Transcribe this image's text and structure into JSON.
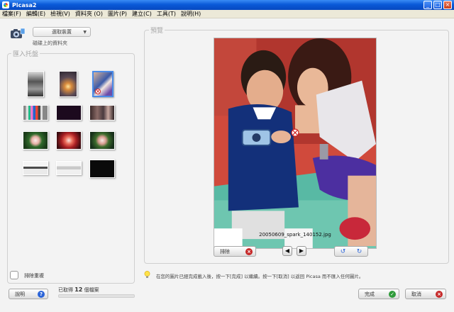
{
  "window": {
    "title": "Picasa2",
    "controls": [
      "_",
      "□",
      "×"
    ]
  },
  "menu": [
    "檔案(F)",
    "編輯(E)",
    "檢視(V)",
    "資料夾 (O)",
    "圖片(P)",
    "建立(C)",
    "工具(T)",
    "說明(H)"
  ],
  "source": {
    "select_label": "選取裝置",
    "caption": "磁碟上的資料夾"
  },
  "tray": {
    "label": "匯入托盤",
    "thumbnails": [
      {
        "name": "portrait-gray",
        "selected": false,
        "excluded": false
      },
      {
        "name": "sunset",
        "selected": false,
        "excluded": false
      },
      {
        "name": "boy-and-woman",
        "selected": true,
        "excluded": true
      },
      {
        "name": "color-bars",
        "selected": false,
        "excluded": false
      },
      {
        "name": "dark-purple",
        "selected": false,
        "excluded": false
      },
      {
        "name": "group-photo",
        "selected": false,
        "excluded": false
      },
      {
        "name": "flower-green",
        "selected": false,
        "excluded": false
      },
      {
        "name": "flower-red",
        "selected": false,
        "excluded": false
      },
      {
        "name": "flower-green-2",
        "selected": false,
        "excluded": false
      },
      {
        "name": "screenshot-dark",
        "selected": false,
        "excluded": false
      },
      {
        "name": "screenshot-light",
        "selected": false,
        "excluded": false
      },
      {
        "name": "black",
        "selected": false,
        "excluded": false
      }
    ]
  },
  "duplicates_label": "排除重複",
  "help_button": "說明",
  "status": {
    "prefix": "已取得 ",
    "count": "12",
    "suffix": " 個檔案",
    "progress": 0
  },
  "preview": {
    "label": "預覽",
    "filename": "20050609_spark_140152.jpg",
    "exclude_button": "排除"
  },
  "hint": "在您的圖片已經完成載入後，按一下[完成] 以繼續。按一下[取消] 以返回 Picasa 而不匯入任何圖片。",
  "footer": {
    "finish_button": "完成",
    "cancel_button": "取消"
  },
  "colors": {
    "titlebar": "#0a5ad8",
    "selection": "#4a8be8",
    "exclude": "#c62a2a",
    "finish": "#2f9b3a"
  }
}
